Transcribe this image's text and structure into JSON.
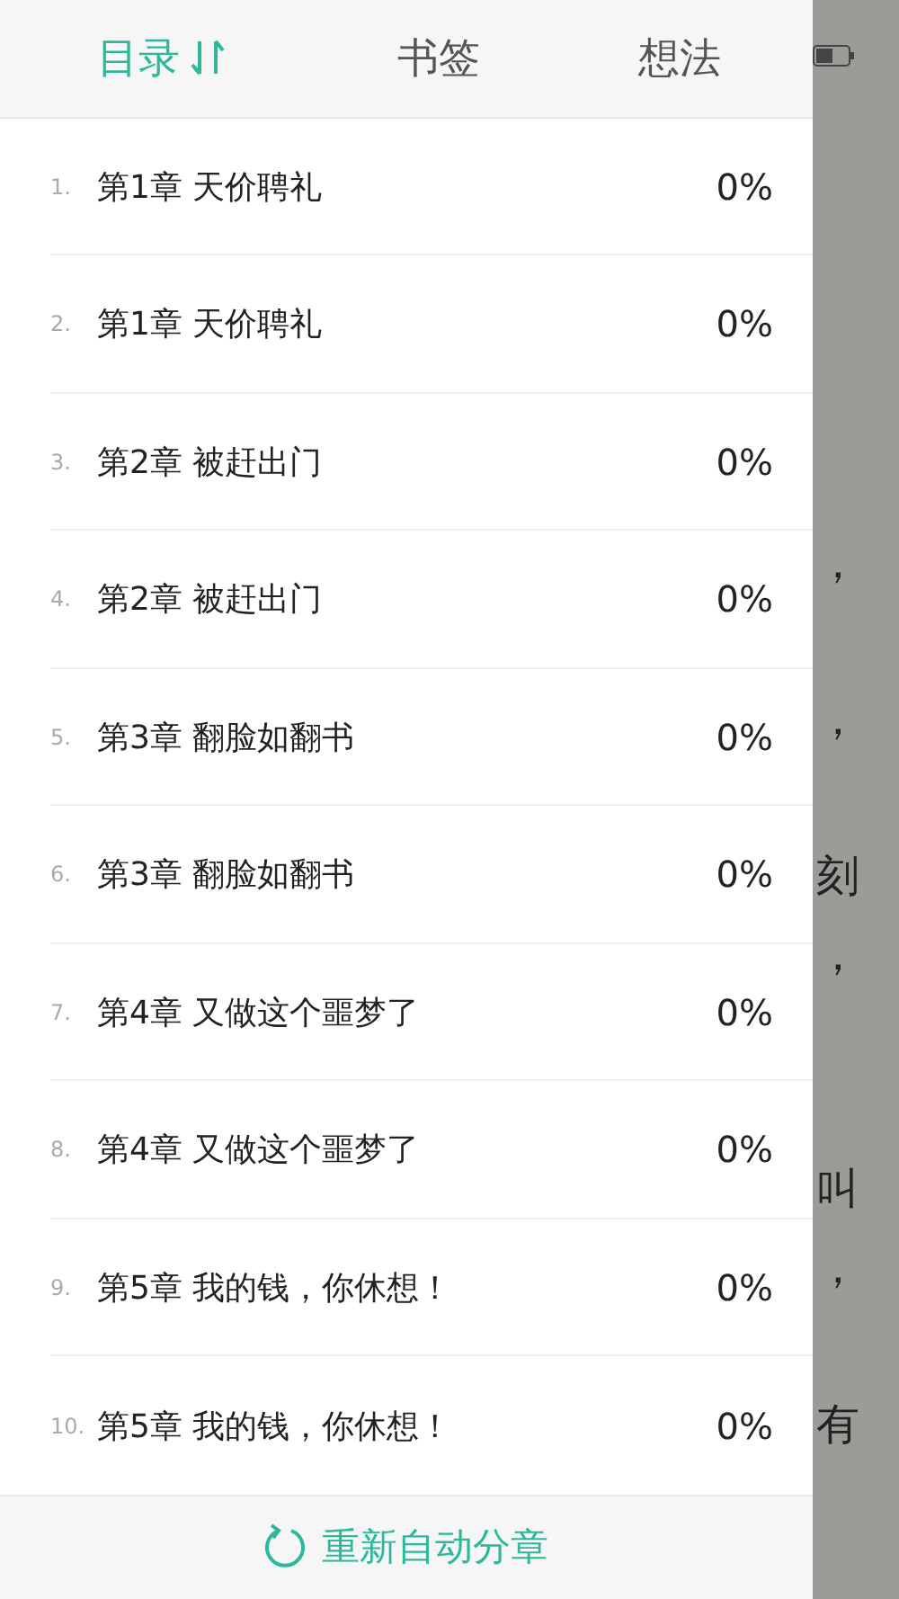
{
  "tabs": [
    {
      "label": "目录",
      "selected": true,
      "sort_icon": true
    },
    {
      "label": "书签",
      "selected": false,
      "sort_icon": false
    },
    {
      "label": "想法",
      "selected": false,
      "sort_icon": false
    }
  ],
  "chapters": [
    {
      "index": "1.",
      "title": "第1章 天价聘礼",
      "progress": "0%"
    },
    {
      "index": "2.",
      "title": "第1章 天价聘礼",
      "progress": "0%"
    },
    {
      "index": "3.",
      "title": "第2章 被赶出门",
      "progress": "0%"
    },
    {
      "index": "4.",
      "title": "第2章 被赶出门",
      "progress": "0%"
    },
    {
      "index": "5.",
      "title": "第3章 翻脸如翻书",
      "progress": "0%"
    },
    {
      "index": "6.",
      "title": "第3章 翻脸如翻书",
      "progress": "0%"
    },
    {
      "index": "7.",
      "title": "第4章 又做这个噩梦了",
      "progress": "0%"
    },
    {
      "index": "8.",
      "title": "第4章 又做这个噩梦了",
      "progress": "0%"
    },
    {
      "index": "9.",
      "title": "第5章 我的钱，你休想！",
      "progress": "0%"
    },
    {
      "index": "10.",
      "title": "第5章 我的钱，你休想！",
      "progress": "0%"
    }
  ],
  "footer": {
    "label": "重新自动分章"
  },
  "page_behind": {
    "fragments": [
      "，",
      "，",
      "刻",
      "，",
      "叫",
      "，",
      "有"
    ]
  }
}
